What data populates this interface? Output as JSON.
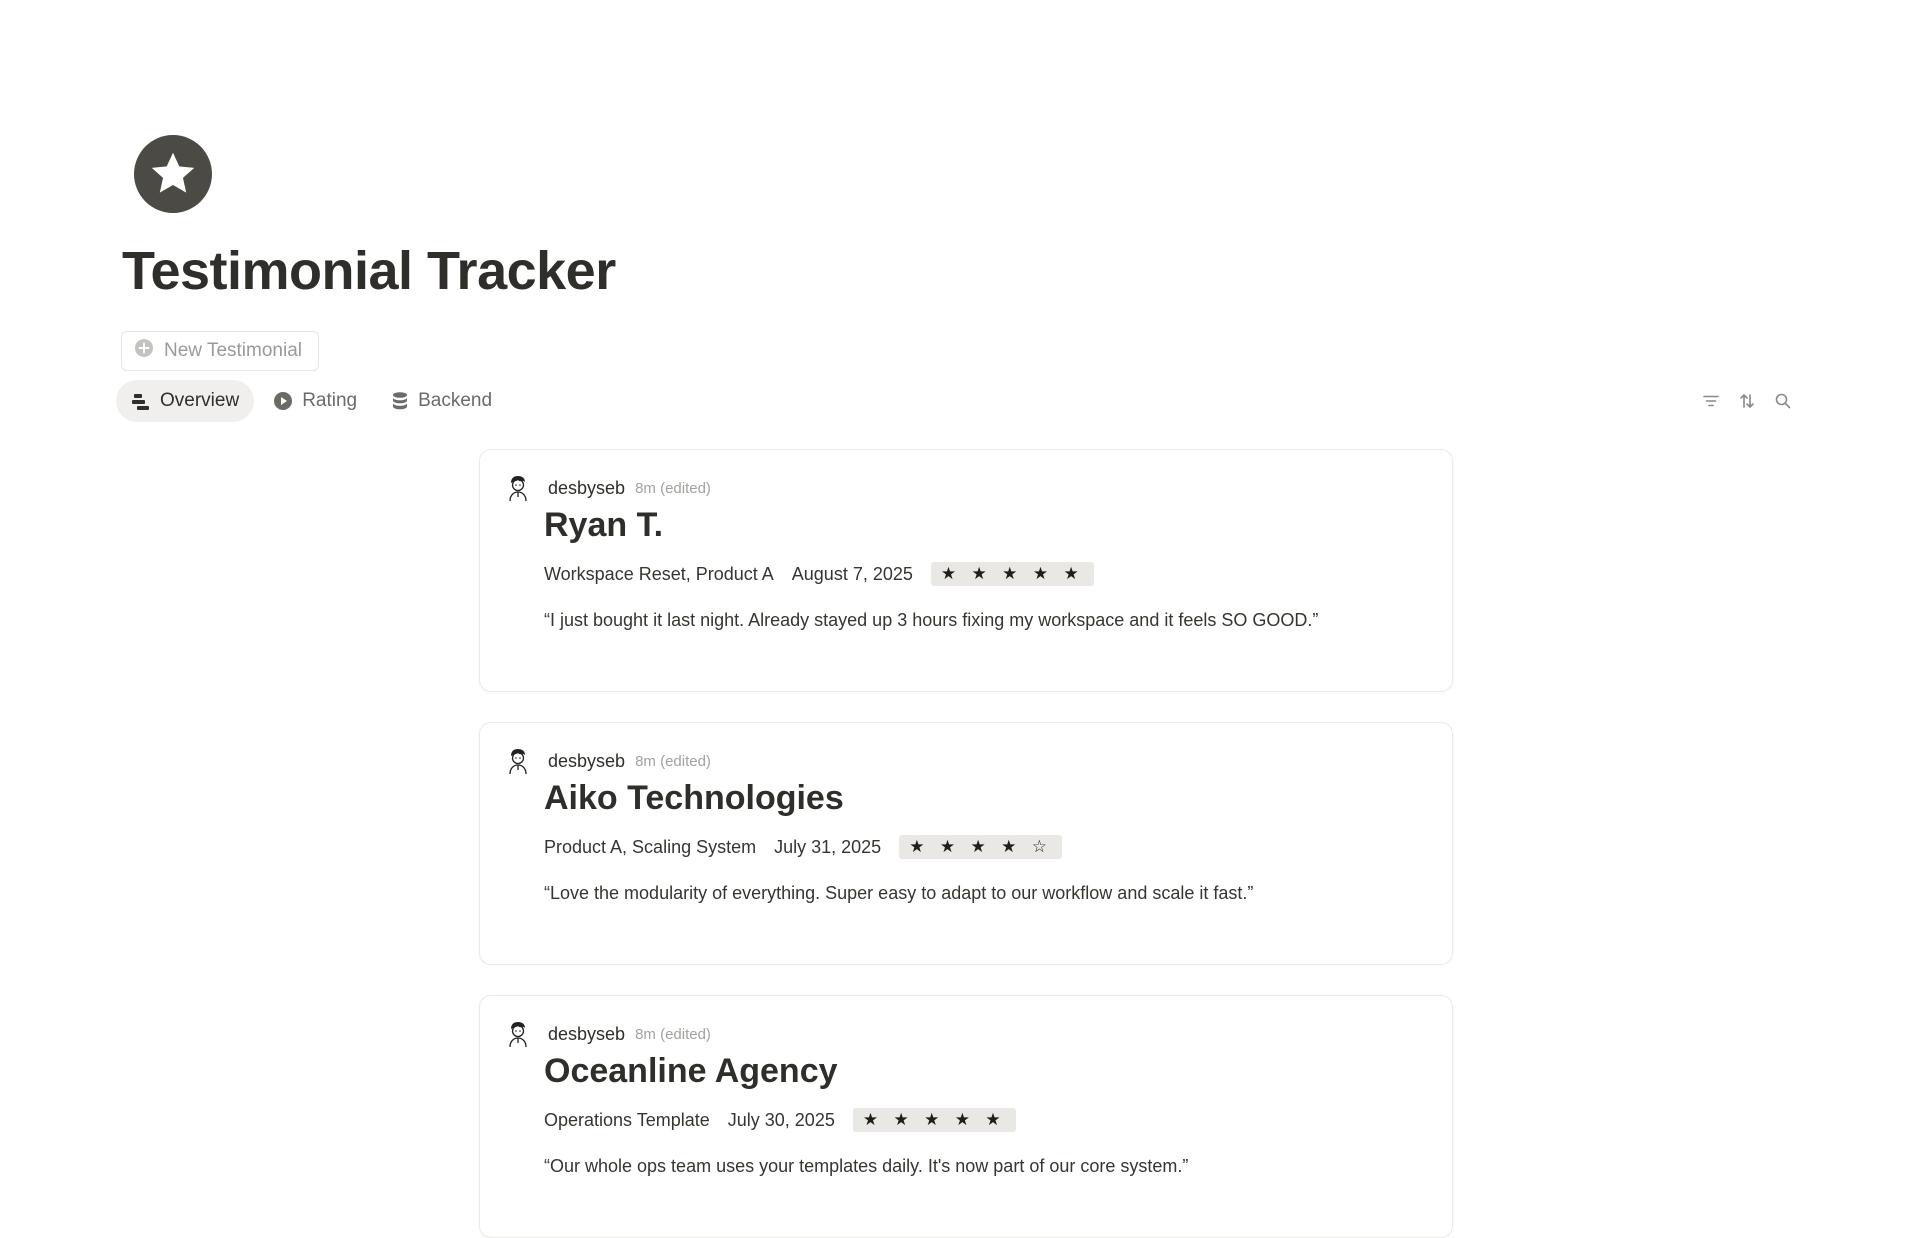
{
  "page": {
    "icon": "star-circle-icon",
    "title": "Testimonial Tracker"
  },
  "new_button": {
    "label": "New Testimonial",
    "icon": "plus-circle-icon"
  },
  "tabs": [
    {
      "label": "Overview",
      "icon": "board-icon",
      "active": true
    },
    {
      "label": "Rating",
      "icon": "play-circle-icon",
      "active": false
    },
    {
      "label": "Backend",
      "icon": "database-icon",
      "active": false
    }
  ],
  "toolbar": {
    "icons": [
      "filter-icon",
      "sort-icon",
      "search-icon"
    ]
  },
  "cards": [
    {
      "author": "desbyseb",
      "time": "8m (edited)",
      "title": "Ryan T.",
      "products": "Workspace Reset, Product A",
      "date": "August 7, 2025",
      "stars": "★ ★ ★ ★ ★",
      "rating": 5,
      "quote": "“I just bought it last night. Already stayed up 3 hours fixing my workspace and it feels SO GOOD.”"
    },
    {
      "author": "desbyseb",
      "time": "8m (edited)",
      "title": "Aiko Technologies",
      "products": "Product A, Scaling System",
      "date": "July 31, 2025",
      "stars": "★ ★ ★ ★ ☆",
      "rating": 4,
      "quote": "“Love the modularity of everything. Super easy to adapt to our workflow and scale it fast.”"
    },
    {
      "author": "desbyseb",
      "time": "8m (edited)",
      "title": "Oceanline Agency",
      "products": "Operations Template",
      "date": "July 30, 2025",
      "stars": "★ ★ ★ ★ ★",
      "rating": 5,
      "quote": "“Our whole ops team uses your templates daily. It's now part of our core system.”"
    }
  ],
  "colors": {
    "text": "#37352f",
    "muted": "#9b9a97",
    "icon_bg": "#4b4a45",
    "star_bg": "#e9e8e5"
  }
}
